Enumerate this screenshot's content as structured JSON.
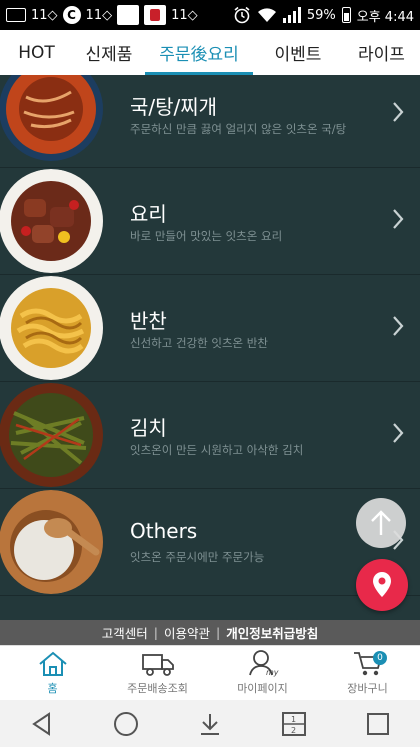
{
  "status_bar": {
    "left_items": [
      "11◇",
      "11◇",
      "11◇"
    ],
    "badge_letter": "C",
    "battery": "59%",
    "time": "오후 4:44"
  },
  "tabs": [
    {
      "label": "HOT"
    },
    {
      "label": "신제품"
    },
    {
      "label": "주문後요리",
      "active": true
    },
    {
      "label": "이벤트"
    },
    {
      "label": "라이프"
    }
  ],
  "categories": [
    {
      "title": "국/탕/찌개",
      "subtitle": "주문하신 만큼 끓여 얼리지 않은 잇츠온 국/탕"
    },
    {
      "title": "요리",
      "subtitle": "바로 만들어 맛있는 잇츠온 요리"
    },
    {
      "title": "반찬",
      "subtitle": "신선하고 건강한 잇츠온 반찬"
    },
    {
      "title": "김치",
      "subtitle": "잇츠온이 만든 시원하고 아삭한 김치"
    },
    {
      "title": "Others",
      "subtitle": "잇츠온 주문시에만 주문가능"
    }
  ],
  "footer_links": {
    "customer_center": "고객센터",
    "terms": "이용약관",
    "privacy": "개인정보취급방침"
  },
  "bottom_nav": [
    {
      "label": "홈",
      "icon": "home-icon"
    },
    {
      "label": "주문배송조회",
      "icon": "truck-icon"
    },
    {
      "label": "마이페이지",
      "icon": "mypage-icon",
      "icon_text": "my"
    },
    {
      "label": "장바구니",
      "icon": "cart-icon",
      "badge": "0"
    }
  ],
  "colors": {
    "accent": "#1b8fb4",
    "list_bg": "#23383a",
    "location_button": "#e8294a"
  },
  "system_nav": {
    "recent_apps_label_top": "1",
    "recent_apps_label_bottom": "2"
  }
}
